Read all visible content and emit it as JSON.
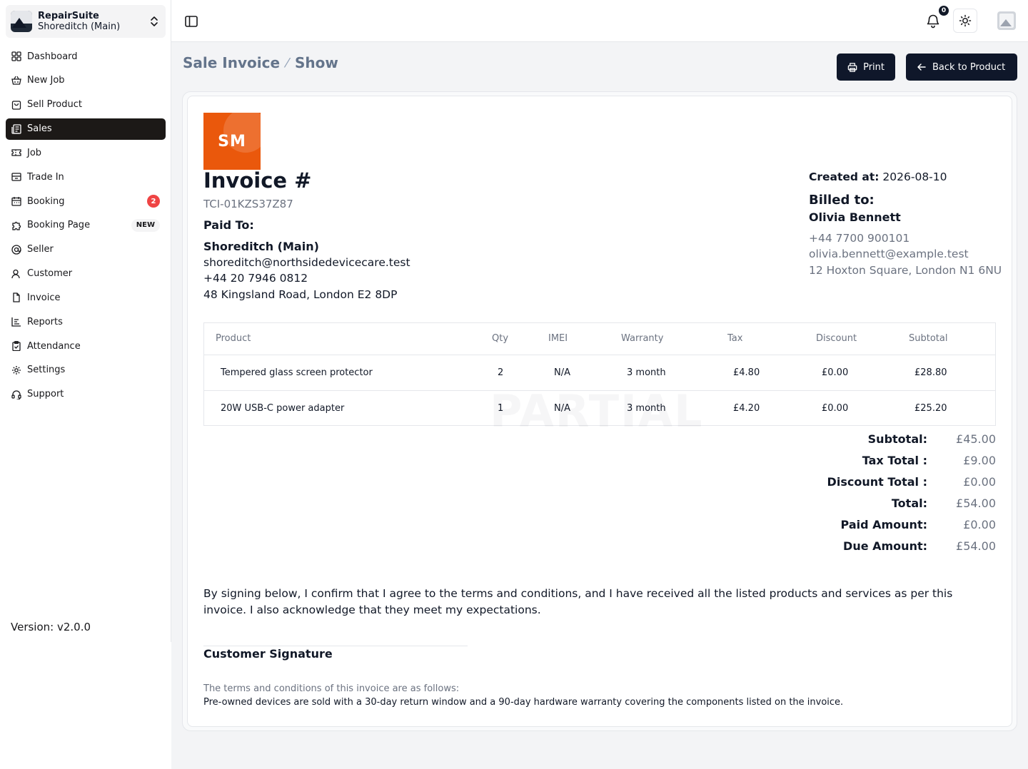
{
  "app": {
    "name": "RepairSuite",
    "branch": "Shoreditch (Main)",
    "version": "Version: v2.0.0"
  },
  "sidebar": {
    "items": [
      {
        "label": "Dashboard",
        "icon": "dashboard-icon"
      },
      {
        "label": "New Job",
        "icon": "basket-icon"
      },
      {
        "label": "Sell Product",
        "icon": "shopping-bag-icon"
      },
      {
        "label": "Sales",
        "icon": "receipt-icon",
        "active": true
      },
      {
        "label": "Job",
        "icon": "ticket-icon"
      },
      {
        "label": "Trade In",
        "icon": "archive-box-icon"
      },
      {
        "label": "Booking",
        "icon": "calendar-icon",
        "badge": "2"
      },
      {
        "label": "Booking Page",
        "icon": "puzzle-icon",
        "tag": "NEW"
      },
      {
        "label": "Seller",
        "icon": "at-sign-icon"
      },
      {
        "label": "Customer",
        "icon": "user-icon"
      },
      {
        "label": "Invoice",
        "icon": "file-icon"
      },
      {
        "label": "Reports",
        "icon": "chart-icon"
      },
      {
        "label": "Attendance",
        "icon": "clipboard-check-icon"
      },
      {
        "label": "Settings",
        "icon": "gear-icon"
      },
      {
        "label": "Support",
        "icon": "headset-icon"
      }
    ]
  },
  "header": {
    "notification_count": "0"
  },
  "page": {
    "breadcrumb_parent": "Sale Invoice",
    "breadcrumb_sep": "⁄",
    "breadcrumb_current": "Show",
    "print_label": "Print",
    "back_label": "Back to Product"
  },
  "invoice": {
    "logo_text": "SM",
    "title": "Invoice #",
    "number": "TCI-01KZS37Z87",
    "paid_to_label": "Paid To:",
    "seller": {
      "name": "Shoreditch (Main)",
      "email": "shoreditch@northsidedevicecare.test",
      "phone": "+44 20 7946 0812",
      "address": "48 Kingsland Road, London E2 8DP"
    },
    "created_label": "Created at:",
    "created_value": "2026-08-10",
    "billed_label": "Billed to:",
    "customer": {
      "name": "Olivia Bennett",
      "phone": "+44 7700 900101",
      "email": "olivia.bennett@example.test",
      "address": "12 Hoxton Square, London N1 6NU"
    },
    "columns": [
      "Product",
      "Qty",
      "IMEI",
      "Warranty",
      "Tax",
      "Discount",
      "Subtotal"
    ],
    "rows": [
      [
        "Tempered glass screen protector",
        "2",
        "N/A",
        "3 month",
        "£4.80",
        "£0.00",
        "£28.80"
      ],
      [
        "20W USB-C power adapter",
        "1",
        "N/A",
        "3 month",
        "£4.20",
        "£0.00",
        "£25.20"
      ]
    ],
    "watermark": "PARTIAL",
    "totals": [
      {
        "label": "Subtotal:",
        "value": "£45.00"
      },
      {
        "label": "Tax Total :",
        "value": "£9.00"
      },
      {
        "label": "Discount Total :",
        "value": "£0.00"
      },
      {
        "label": "Total:",
        "value": "£54.00"
      },
      {
        "label": "Paid Amount:",
        "value": "£0.00"
      },
      {
        "label": "Due Amount:",
        "value": "£54.00"
      }
    ],
    "agreement": "By signing below, I confirm that I agree to the terms and conditions, and I have received all the listed products and services as per this invoice. I also acknowledge that they meet my expectations.",
    "signature_label": "Customer Signature",
    "terms_title": "The terms and conditions of this invoice are as follows:",
    "terms_text": "Pre-owned devices are sold with a 30-day return window and a 90-day hardware warranty covering the components listed on the invoice."
  }
}
